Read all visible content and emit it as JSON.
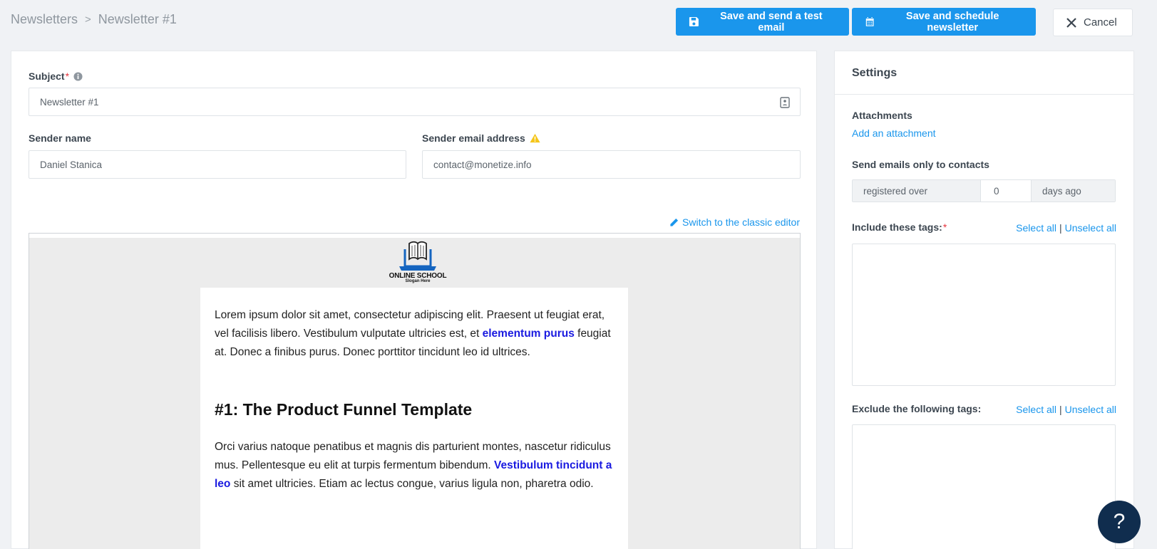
{
  "breadcrumb": {
    "root": "Newsletters",
    "separator": ">",
    "current": "Newsletter #1"
  },
  "toolbar": {
    "test_label": "Save and send a test email",
    "schedule_label": "Save and schedule newsletter",
    "cancel_label": "Cancel"
  },
  "form": {
    "subject_label": "Subject",
    "required_mark": "*",
    "subject_value": "Newsletter #1",
    "sender_name_label": "Sender name",
    "sender_name_value": "Daniel Stanica",
    "sender_email_label": "Sender email address",
    "sender_email_value": "contact@monetize.info",
    "classic_editor_link": "Switch to the classic editor"
  },
  "email": {
    "logo_text": "ONLINE SCHOOL",
    "logo_slogan": "Slogan Here",
    "p1_a": "Lorem ipsum dolor sit amet, consectetur adipiscing elit. Praesent ut feugiat erat, vel facilisis libero. Vestibulum vulputate ultricies est, et ",
    "p1_link": "elementum purus",
    "p1_b": " feugiat at. Donec a finibus purus. Donec porttitor tincidunt leo id ultrices.",
    "heading": "#1: The Product Funnel Template",
    "p2_a": "Orci varius natoque penatibus et magnis dis parturient montes, nascetur ridiculus mus. Pellentesque eu elit at turpis fermentum bibendum. ",
    "p2_link": "Vestibulum tincidunt a leo",
    "p2_b": " sit amet ultricies. Etiam ac lectus congue, varius ligula non, pharetra odio."
  },
  "settings": {
    "title": "Settings",
    "attachments_label": "Attachments",
    "add_attachment": "Add an attachment",
    "send_only_label": "Send emails only to contacts",
    "registered_over": "registered over",
    "days_value": "0",
    "days_ago": "days ago",
    "include_tags_label": "Include these tags:",
    "exclude_tags_label": "Exclude the following tags:",
    "select_all": "Select all",
    "divider": "|",
    "unselect_all": "Unselect all"
  },
  "help": {
    "label": "?"
  },
  "colors": {
    "accent": "#1a96ec",
    "help_bg": "#102d4e",
    "required": "#e5343d",
    "warning": "#f5c518"
  }
}
